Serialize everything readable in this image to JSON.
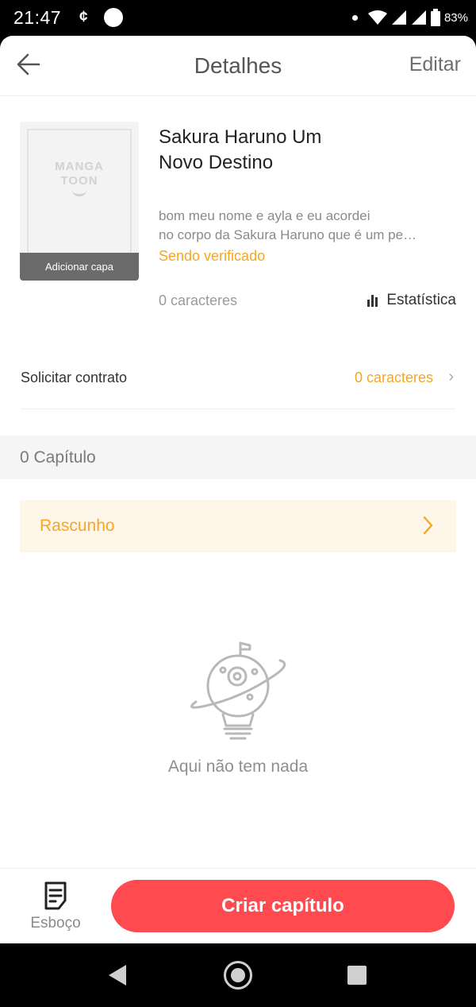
{
  "status_bar": {
    "time": "21:47",
    "carrier_glyph": "¢",
    "battery": "83%",
    "icons": [
      "circle-notification-icon",
      "dot-icon",
      "wifi-icon",
      "signal-icon",
      "signal-icon",
      "battery-icon"
    ]
  },
  "header": {
    "title": "Detalhes",
    "edit_label": "Editar",
    "back_icon": "arrow-left-icon"
  },
  "book": {
    "cover_logo_line1": "MANGA",
    "cover_logo_line2": "TOON",
    "cover_label": "Adicionar capa",
    "title_line1": "Sakura Haruno Um",
    "title_line2": "Novo Destino",
    "description_line1": "bom meu nome e ayla e eu acordei",
    "description_line2": "no corpo da Sakura Haruno que é um pe…",
    "status": "Sendo verificado",
    "char_count": "0 caracteres",
    "stats_label": "Estatística",
    "stats_icon": "bar-chart-icon"
  },
  "contract": {
    "label": "Solicitar contrato",
    "value": "0 caracteres",
    "chevron": "›"
  },
  "chapters": {
    "count_label": "0 Capítulo",
    "draft_label": "Rascunho"
  },
  "empty_state": {
    "icon": "planet-lightbulb-icon",
    "text": "Aqui não tem nada"
  },
  "bottom_bar": {
    "draft_tab_label": "Esboço",
    "draft_tab_icon": "notes-icon",
    "create_button": "Criar capítulo"
  },
  "colors": {
    "accent_orange": "#f5a623",
    "primary_red": "#ff4a4f",
    "draft_bg": "#fff6ea"
  }
}
